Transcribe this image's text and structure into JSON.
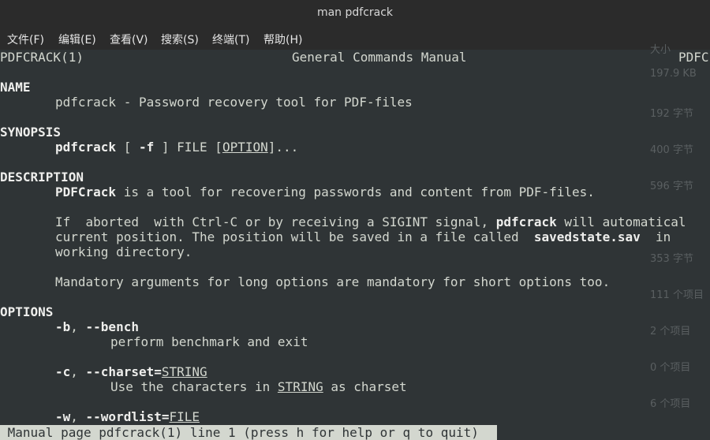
{
  "window": {
    "title": "man pdfcrack"
  },
  "menu": [
    "文件(F)",
    "编辑(E)",
    "查看(V)",
    "搜索(S)",
    "终端(T)",
    "帮助(H)"
  ],
  "side_values": [
    "大小",
    "197.9 KB",
    "192 字节",
    "400 字节",
    "596 字节",
    "(…)",
    "353 字节",
    "111 个项目",
    "2 个项目",
    "0 个项目",
    "6 个项目"
  ],
  "man": {
    "header_left": "PDFCRACK(1)",
    "header_center": "General Commands Manual",
    "header_right": "PDFC",
    "name_heading": "NAME",
    "name_text": "pdfcrack - Password recovery tool for PDF-files",
    "synopsis_heading": "SYNOPSIS",
    "syn_cmd": "pdfcrack",
    "syn_mid1": " [ ",
    "syn_flag": "-f",
    "syn_mid2": " ] FILE [",
    "syn_opt": "OPTION",
    "syn_end": "]...",
    "desc_heading": "DESCRIPTION",
    "desc1_bold": "PDFCrack",
    "desc1_rest": " is a tool for recovering passwords and content from PDF-files.",
    "desc2_a": "If  aborted  with Ctrl-C or by receiving a SIGINT signal, ",
    "desc2_bold": "pdfcrack",
    "desc2_b": " will automatical",
    "desc3_a": "current position. The position will be saved in a file called  ",
    "desc3_bold": "savedstate.sav",
    "desc3_b": "  in",
    "desc4": "working directory.",
    "desc5": "Mandatory arguments for long options are mandatory for short options too.",
    "options_heading": "OPTIONS",
    "opt_b": "-b",
    "opt_b_sep": ", ",
    "opt_bench": "--bench",
    "opt_b_desc": "perform benchmark and exit",
    "opt_c": "-c",
    "opt_c_sep": ", ",
    "opt_charset": "--charset=",
    "opt_c_arg": "STRING",
    "opt_c_desc_a": "Use the characters in ",
    "opt_c_desc_arg": "STRING",
    "opt_c_desc_b": " as charset",
    "opt_w": "-w",
    "opt_w_sep": ", ",
    "opt_wordlist": "--wordlist=",
    "opt_w_arg": "FILE",
    "status": " Manual page pdfcrack(1) line 1 (press h for help or q to quit)"
  }
}
